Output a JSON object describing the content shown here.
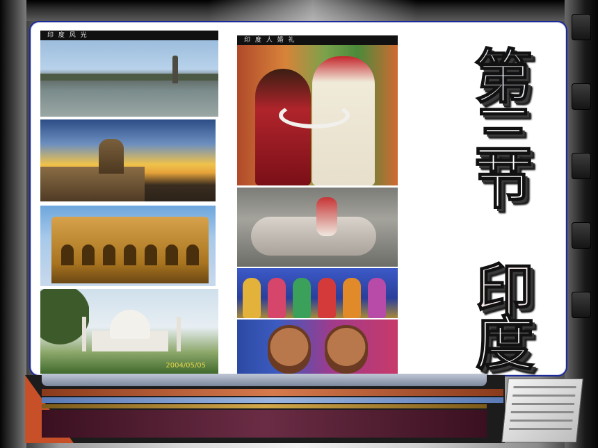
{
  "slide": {
    "title_chars": [
      "第",
      "三",
      "节",
      "印",
      "度"
    ],
    "left_caption": "印 度 风 光",
    "right_caption": "印 度 人 婚 礼",
    "photo_date": "2004/05/05"
  },
  "colors": {
    "panel_border": "#1b2a99",
    "accent_orange": "#c85028",
    "stripe_blue": "#9bb6e0",
    "stripe_maroon": "#6a2c44"
  }
}
